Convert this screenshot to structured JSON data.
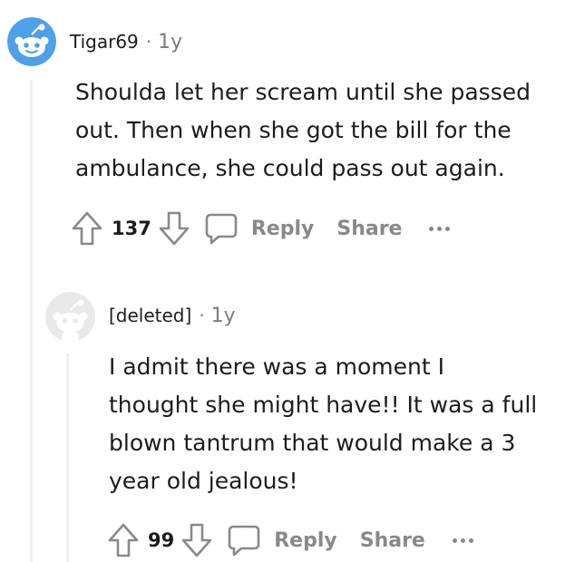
{
  "comments": [
    {
      "username": "Tigar69",
      "separator": "·",
      "age": "1y",
      "avatar_icon": "snoo-avatar-icon",
      "lines": [
        "Shoulda let her scream until she passed",
        "out. Then when she got the bill for the",
        "ambulance, she could pass out again."
      ],
      "score": "137",
      "reply_label": "Reply",
      "share_label": "Share"
    },
    {
      "username": "[deleted]",
      "separator": "·",
      "age": "1y",
      "avatar_icon": "deleted-user-avatar-icon",
      "lines": [
        "I admit there was a moment I",
        "thought she might have!! It was a full",
        "blown tantrum that would make a 3",
        "year old jealous!"
      ],
      "score": "99",
      "reply_label": "Reply",
      "share_label": "Share"
    }
  ],
  "colors": {
    "avatar_blue": "#4fa0e6",
    "deleted_gray": "#e8e9ea",
    "muted_text": "#878a8c",
    "thread_line": "#edeff1"
  }
}
